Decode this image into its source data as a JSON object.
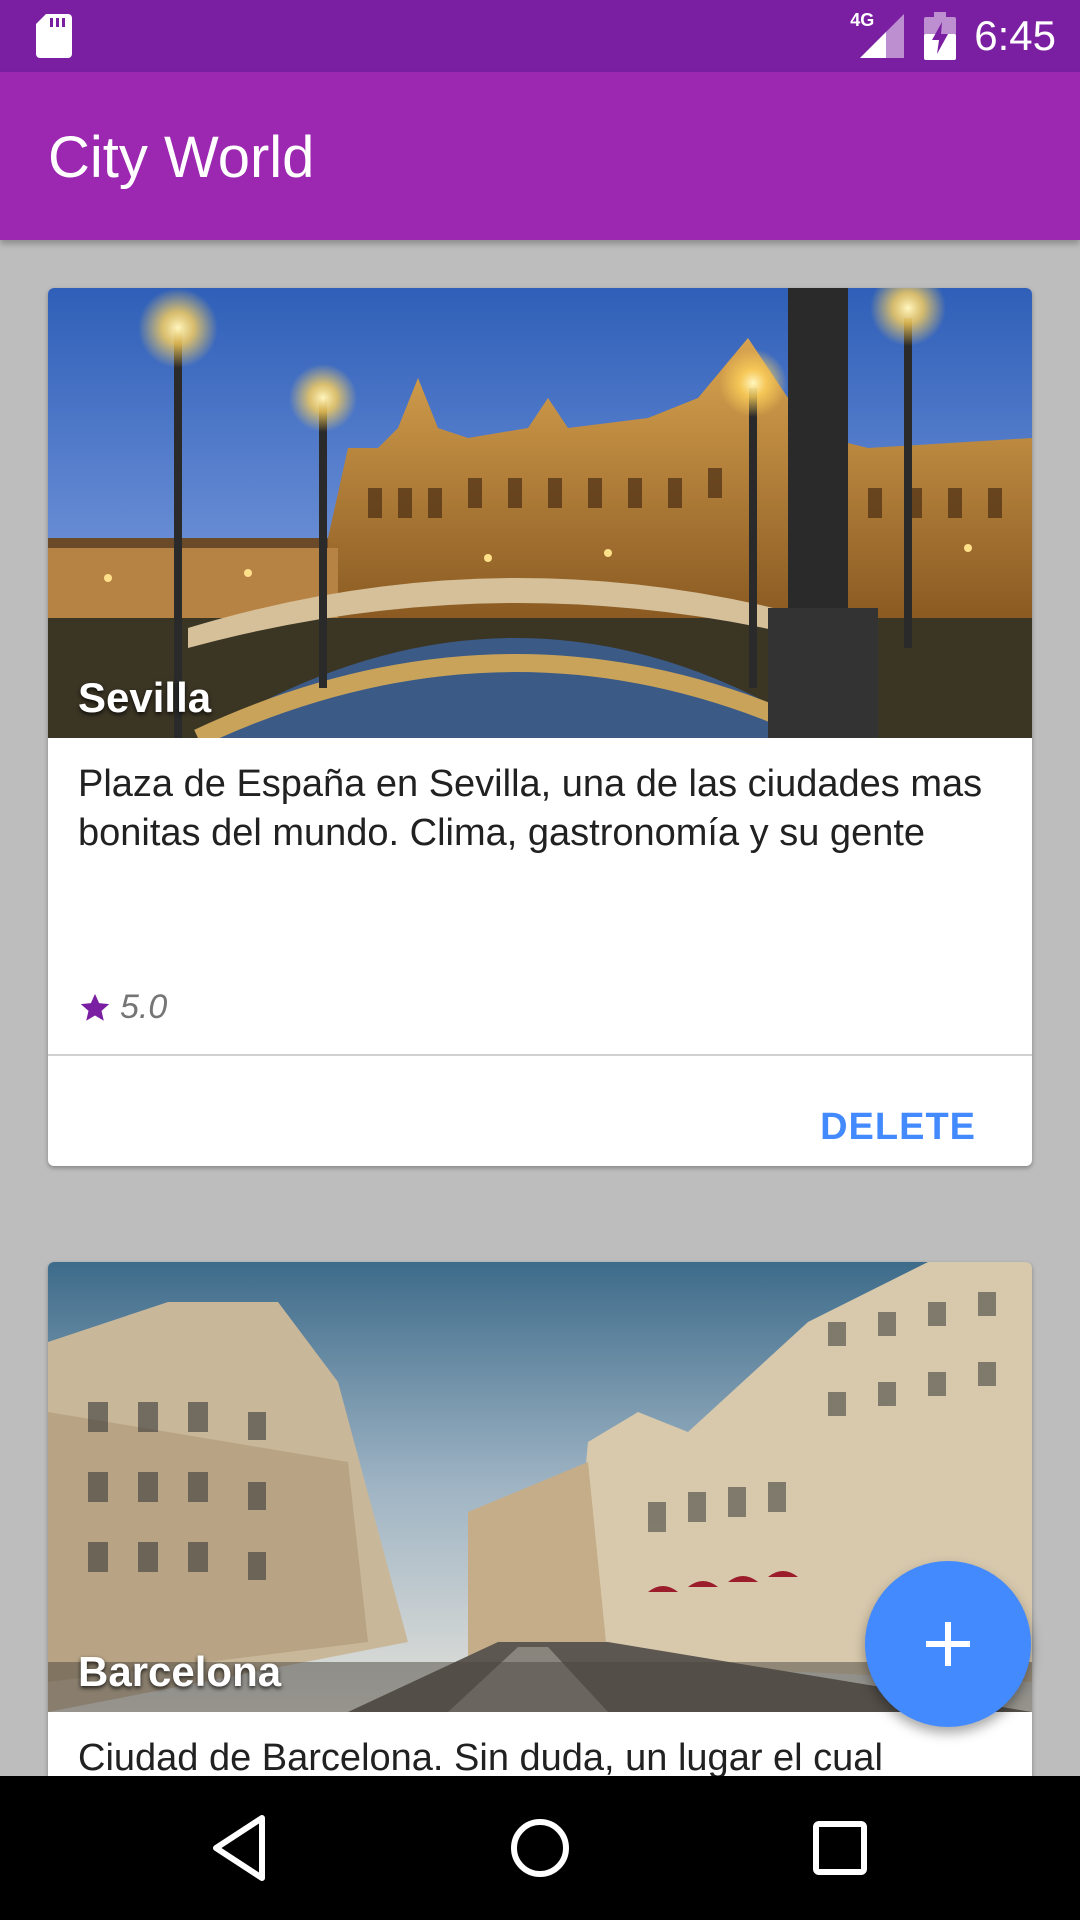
{
  "status_bar": {
    "network": "4G",
    "time": "6:45",
    "icons": [
      "sd-card-icon",
      "signal-icon",
      "battery-charging-icon"
    ]
  },
  "app_bar": {
    "title": "City World"
  },
  "cards": [
    {
      "city": "Sevilla",
      "description": "Plaza de España en Sevilla, una de las ciudades mas bonitas del mundo. Clima, gastronomía y su gente",
      "rating": "5.0",
      "delete_label": "DELETE"
    },
    {
      "city": "Barcelona",
      "description": "Ciudad de Barcelona. Sin duda, un lugar el cual"
    }
  ],
  "fab": {
    "icon": "plus-icon"
  },
  "nav": {
    "icons": [
      "back-icon",
      "home-icon",
      "recents-icon"
    ]
  },
  "colors": {
    "status_bar": "#7b1fa2",
    "app_bar": "#9c27b0",
    "accent": "#448aff",
    "star": "#7b1fa2"
  }
}
